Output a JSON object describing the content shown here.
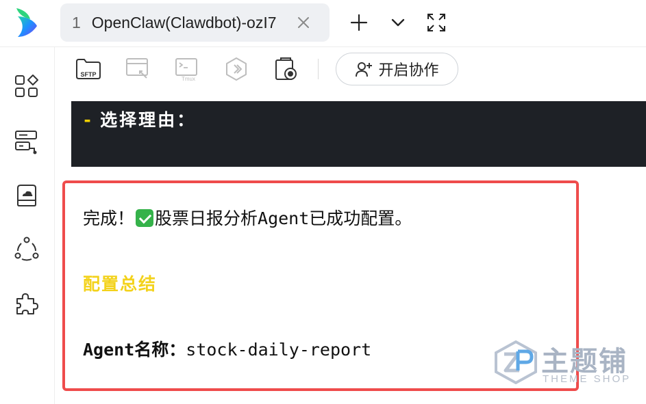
{
  "tab": {
    "number": "1",
    "title": "OpenClaw(Clawdbot)-ozI7"
  },
  "toolbar": {
    "sftp_label": "SFTP",
    "tmux_label": "Tmux",
    "collab_label": "开启协作"
  },
  "terminal": {
    "dash": "-",
    "line": "选择理由："
  },
  "panel": {
    "line1_before": "完成！",
    "line1_after": "股票日报分析Agent已成功配置。",
    "heading": "配置总结",
    "agent_key": "Agent名称：",
    "agent_value": "stock-daily-report"
  },
  "watermark": {
    "cn": "主题铺",
    "en": "THEME SHOP"
  },
  "colors": {
    "accent_red": "#ef4c4c",
    "heading_yellow": "#f3d21b",
    "terminal_bg": "#1e2126",
    "check_green": "#35b24a"
  },
  "icons": {
    "sidebar": [
      "apps-icon",
      "server-icon",
      "cloud-drive-icon",
      "share-icon",
      "plugin-icon"
    ],
    "toolbar": [
      "sftp-folder-icon",
      "remote-desktop-icon",
      "tmux-icon",
      "hexagon-plugin-icon",
      "screen-record-icon",
      "add-user-icon"
    ],
    "top": [
      "plus-icon",
      "chevron-down-icon",
      "fullscreen-icon",
      "close-icon"
    ]
  }
}
